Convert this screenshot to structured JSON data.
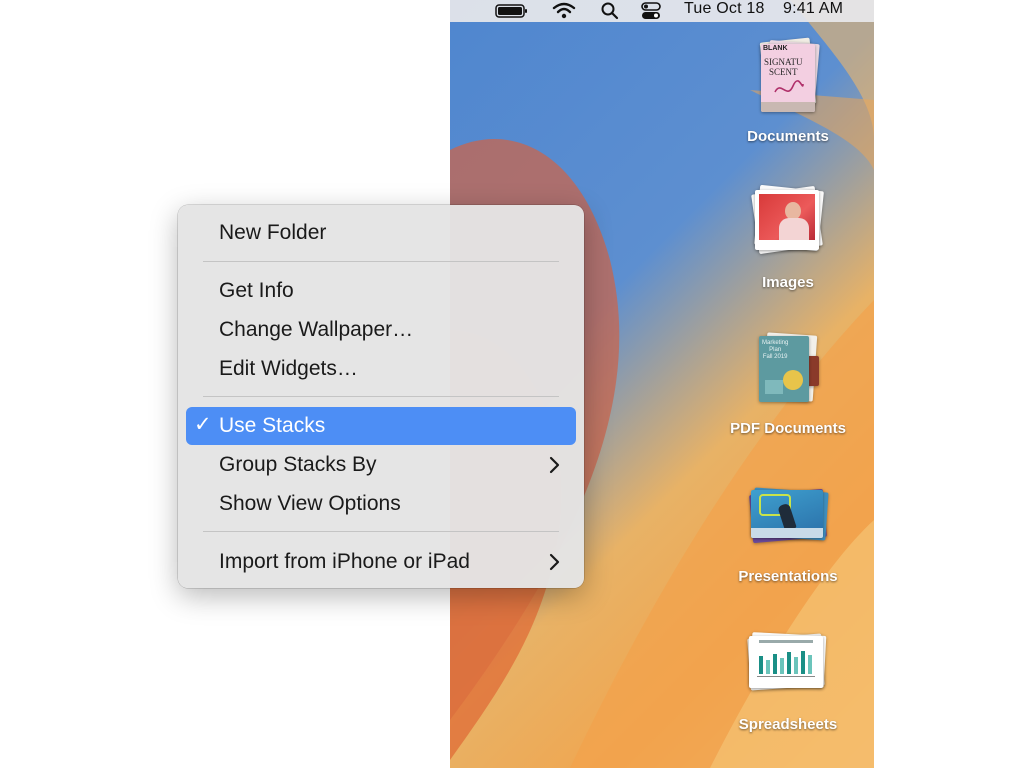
{
  "menubar": {
    "date": "Tue Oct 18",
    "time": "9:41 AM",
    "icons": [
      "battery-icon",
      "wifi-icon",
      "search-icon",
      "control-center-icon"
    ]
  },
  "desktop": {
    "stacks": [
      {
        "label": "Documents",
        "thumb_text": [
          "BLANK",
          "SIGNATU",
          "SCENT"
        ]
      },
      {
        "label": "Images"
      },
      {
        "label": "PDF Documents",
        "thumb_text": [
          "Marketing",
          "Plan",
          "Fall 2019"
        ]
      },
      {
        "label": "Presentations"
      },
      {
        "label": "Spreadsheets"
      }
    ]
  },
  "context_menu": {
    "items": [
      {
        "label": "New Folder"
      },
      {
        "label": "Get Info"
      },
      {
        "label": "Change Wallpaper…"
      },
      {
        "label": "Edit Widgets…"
      },
      {
        "label": "Use Stacks",
        "checked": true,
        "check_mark": "✓"
      },
      {
        "label": "Group Stacks By",
        "submenu": true
      },
      {
        "label": "Show View Options"
      },
      {
        "label": "Import from iPhone or iPad",
        "submenu": true
      }
    ],
    "highlight_color": "#4d8ef5"
  }
}
